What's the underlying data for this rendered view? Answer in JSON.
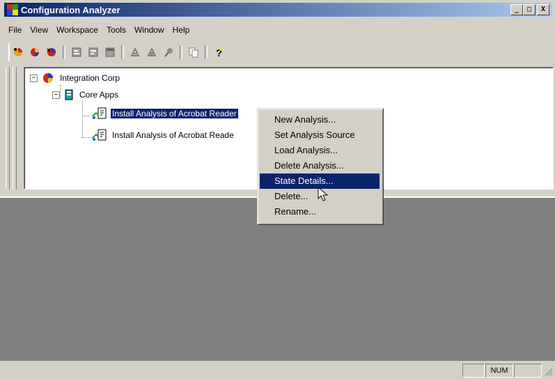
{
  "window": {
    "title": "Configuration Analyzer",
    "minimize": "_",
    "restore": "□",
    "close": "X"
  },
  "menu": [
    "File",
    "View",
    "Workspace",
    "Tools",
    "Window",
    "Help"
  ],
  "toolbar": {
    "icons": [
      "analysis-new-icon",
      "pie-chart-icon",
      "pie-delete-icon",
      "properties-icon",
      "properties2-icon",
      "window-icon",
      "tool-a-icon",
      "tool-b-icon",
      "tool-c-icon",
      "copy-icon",
      "help-icon"
    ]
  },
  "tree": {
    "root": "Integration Corp",
    "group": "Core Apps",
    "items": [
      "Install Analysis of Acrobat Reader",
      "Install Analysis of Acrobat Reade"
    ]
  },
  "context_menu": {
    "items": [
      "New Analysis...",
      "Set Analysis Source",
      "Load Analysis...",
      "Delete Analysis...",
      "State Details...",
      "Delete...",
      "Rename..."
    ],
    "highlighted_index": 4
  },
  "statusbar": {
    "num": "NUM"
  },
  "colors": {
    "titlebar_start": "#0a246a",
    "titlebar_end": "#a6caf0",
    "selection": "#0a246a",
    "face": "#d4d0c8",
    "workspace": "#808080"
  }
}
